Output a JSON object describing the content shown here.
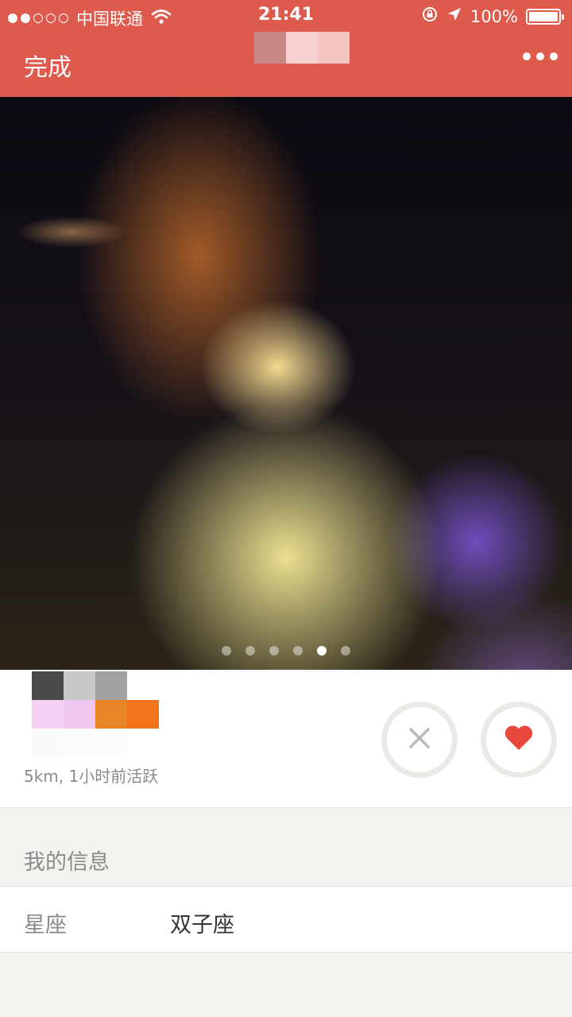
{
  "status_bar": {
    "carrier": "中国联通",
    "time": "21:41",
    "battery": "100%",
    "signal_strength": 2,
    "signal_total": 5
  },
  "nav": {
    "done_label": "完成"
  },
  "photo": {
    "page_count": 6,
    "current_page": 5
  },
  "profile": {
    "distance_activity": "5km, 1小时前活跃"
  },
  "info": {
    "section_title": "我的信息",
    "rows": [
      {
        "key": "星座",
        "value": "双子座"
      }
    ]
  },
  "colors": {
    "accent": "#dd5a4c",
    "like": "#e8473d",
    "pass": "#b9b9b9"
  },
  "icons": {
    "wifi": "wifi-icon",
    "lock_rotation": "orientation-lock-icon",
    "location": "location-arrow-icon",
    "more": "more-dots-icon",
    "pass": "close-icon",
    "like": "heart-icon"
  }
}
